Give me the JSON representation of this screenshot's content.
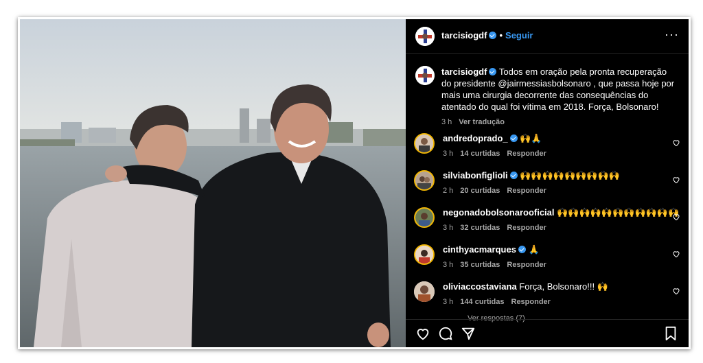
{
  "post": {
    "username": "tarcisiogdf",
    "separator": "•",
    "follow_label": "Seguir",
    "more_label": "···",
    "caption": {
      "username": "tarcisiogdf",
      "text": "Todos em oração pela pronta recuperação do presidente @jairmessiasbolsonaro , que passa hoje por mais uma cirurgia decorrente das consequências do atentado do qual foi vítima em 2018. Força, Bolsonaro!",
      "time": "3 h",
      "translate_label": "Ver tradução"
    }
  },
  "comments": [
    {
      "username": "andredoprado_",
      "verified": true,
      "text": "🙌🙏",
      "time": "3 h",
      "likes": "14 curtidas",
      "reply": "Responder"
    },
    {
      "username": "silviabonfiglioli",
      "verified": true,
      "text": "🙌🙌🙌🙌🙌🙌🙌🙌🙌",
      "time": "2 h",
      "likes": "20 curtidas",
      "reply": "Responder"
    },
    {
      "username": "negonadobolsonarooficial",
      "verified": false,
      "text": "🙌🙌🙌🙌🙌🙌🙌🙌🙌🙌🙌",
      "time": "3 h",
      "likes": "32 curtidas",
      "reply": "Responder"
    },
    {
      "username": "cinthyacmarques",
      "verified": true,
      "text": "🙏",
      "time": "3 h",
      "likes": "35 curtidas",
      "reply": "Responder"
    },
    {
      "username": "oliviaccostaviana",
      "verified": false,
      "text": "Força, Bolsonaro!!! 🙌",
      "time": "3 h",
      "likes": "144 curtidas",
      "reply": "Responder"
    }
  ],
  "more_replies": "Ver respostas (7)",
  "colors": {
    "accent": "#3897f0",
    "background": "#000000",
    "muted": "#a8a8a8"
  },
  "icons": [
    "heart-icon",
    "comment-icon",
    "share-icon",
    "bookmark-icon",
    "more-icon",
    "verified-icon"
  ]
}
